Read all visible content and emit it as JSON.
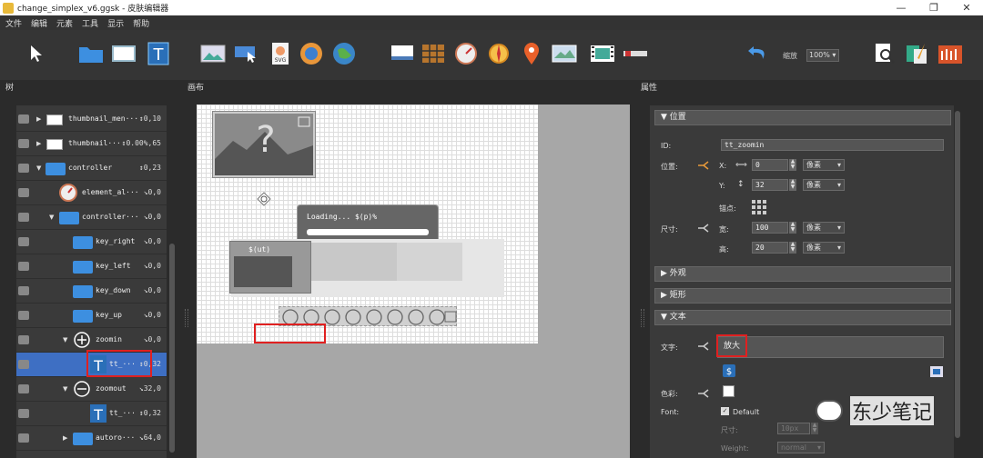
{
  "window": {
    "title": "change_simplex_v6.ggsk - 皮肤编辑器",
    "minimize": "—",
    "maximize": "❐",
    "close": "✕"
  },
  "menu": [
    "文件",
    "编辑",
    "元素",
    "工具",
    "显示",
    "帮助"
  ],
  "toolbar": {
    "zoom_label": "缩放",
    "zoom_value": "100%"
  },
  "panels": {
    "tree": "树",
    "canvas": "画布",
    "properties": "属性"
  },
  "tree": [
    {
      "name": "thumbnail_men···",
      "value": "↕0,10",
      "icon": "thumbnail-icon",
      "level": 1,
      "expander": "▶"
    },
    {
      "name": "thumbnail···",
      "value": "↕0.00%,65",
      "icon": "thumbnail-icon",
      "level": 1,
      "expander": "▶"
    },
    {
      "name": "controller",
      "value": "↕0,23",
      "icon": "folder-icon",
      "level": 1,
      "expander": "▼"
    },
    {
      "name": "element_al···",
      "value": "↘0,0",
      "icon": "gauge-icon",
      "level": 2,
      "expander": ""
    },
    {
      "name": "controller···",
      "value": "↘0,0",
      "icon": "folder-icon",
      "level": 2,
      "expander": "▼"
    },
    {
      "name": "key_right",
      "value": "↘0,0",
      "icon": "folder-icon",
      "level": 3,
      "expander": ""
    },
    {
      "name": "key_left",
      "value": "↘0,0",
      "icon": "folder-icon",
      "level": 3,
      "expander": ""
    },
    {
      "name": "key_down",
      "value": "↘0,0",
      "icon": "folder-icon",
      "level": 3,
      "expander": ""
    },
    {
      "name": "key_up",
      "value": "↘0,0",
      "icon": "folder-icon",
      "level": 3,
      "expander": ""
    },
    {
      "name": "zoomin",
      "value": "↘0,0",
      "icon": "plus-circle-icon",
      "level": 3,
      "expander": "▼"
    },
    {
      "name": "tt_···",
      "value": "↕0,32",
      "icon": "text-icon",
      "level": 4,
      "expander": "",
      "selected": true
    },
    {
      "name": "zoomout",
      "value": "↘32,0",
      "icon": "minus-circle-icon",
      "level": 3,
      "expander": "▼"
    },
    {
      "name": "tt_···",
      "value": "↕0,32",
      "icon": "text-icon",
      "level": 4,
      "expander": ""
    },
    {
      "name": "autoro···",
      "value": "↘64,0",
      "icon": "folder-icon",
      "level": 3,
      "expander": "▶"
    }
  ],
  "canvas": {
    "loading_text": "Loading... $(p)%",
    "tooltip_text": "$(ut)"
  },
  "properties": {
    "section_position": "位置",
    "id_label": "ID:",
    "id_value": "tt_zoomin",
    "position_label": "位置:",
    "x_label": "X:",
    "x_value": "0",
    "x_unit": "像素",
    "y_label": "Y:",
    "y_value": "32",
    "y_unit": "像素",
    "anchor_label": "锚点:",
    "size_label": "尺寸:",
    "width_label": "宽:",
    "width_value": "100",
    "width_unit": "像素",
    "height_label": "高:",
    "height_value": "20",
    "height_unit": "像素",
    "section_appearance": "外观",
    "section_rect": "矩形",
    "section_text": "文本",
    "text_label": "文字:",
    "text_value": "放大",
    "color_label": "色彩:",
    "font_label": "Font:",
    "font_default": "Default",
    "size2_label": "尺寸:",
    "size2_value": "10px",
    "weight_label": "Weight:",
    "weight_value": "normal"
  },
  "watermark": "东少笔记"
}
